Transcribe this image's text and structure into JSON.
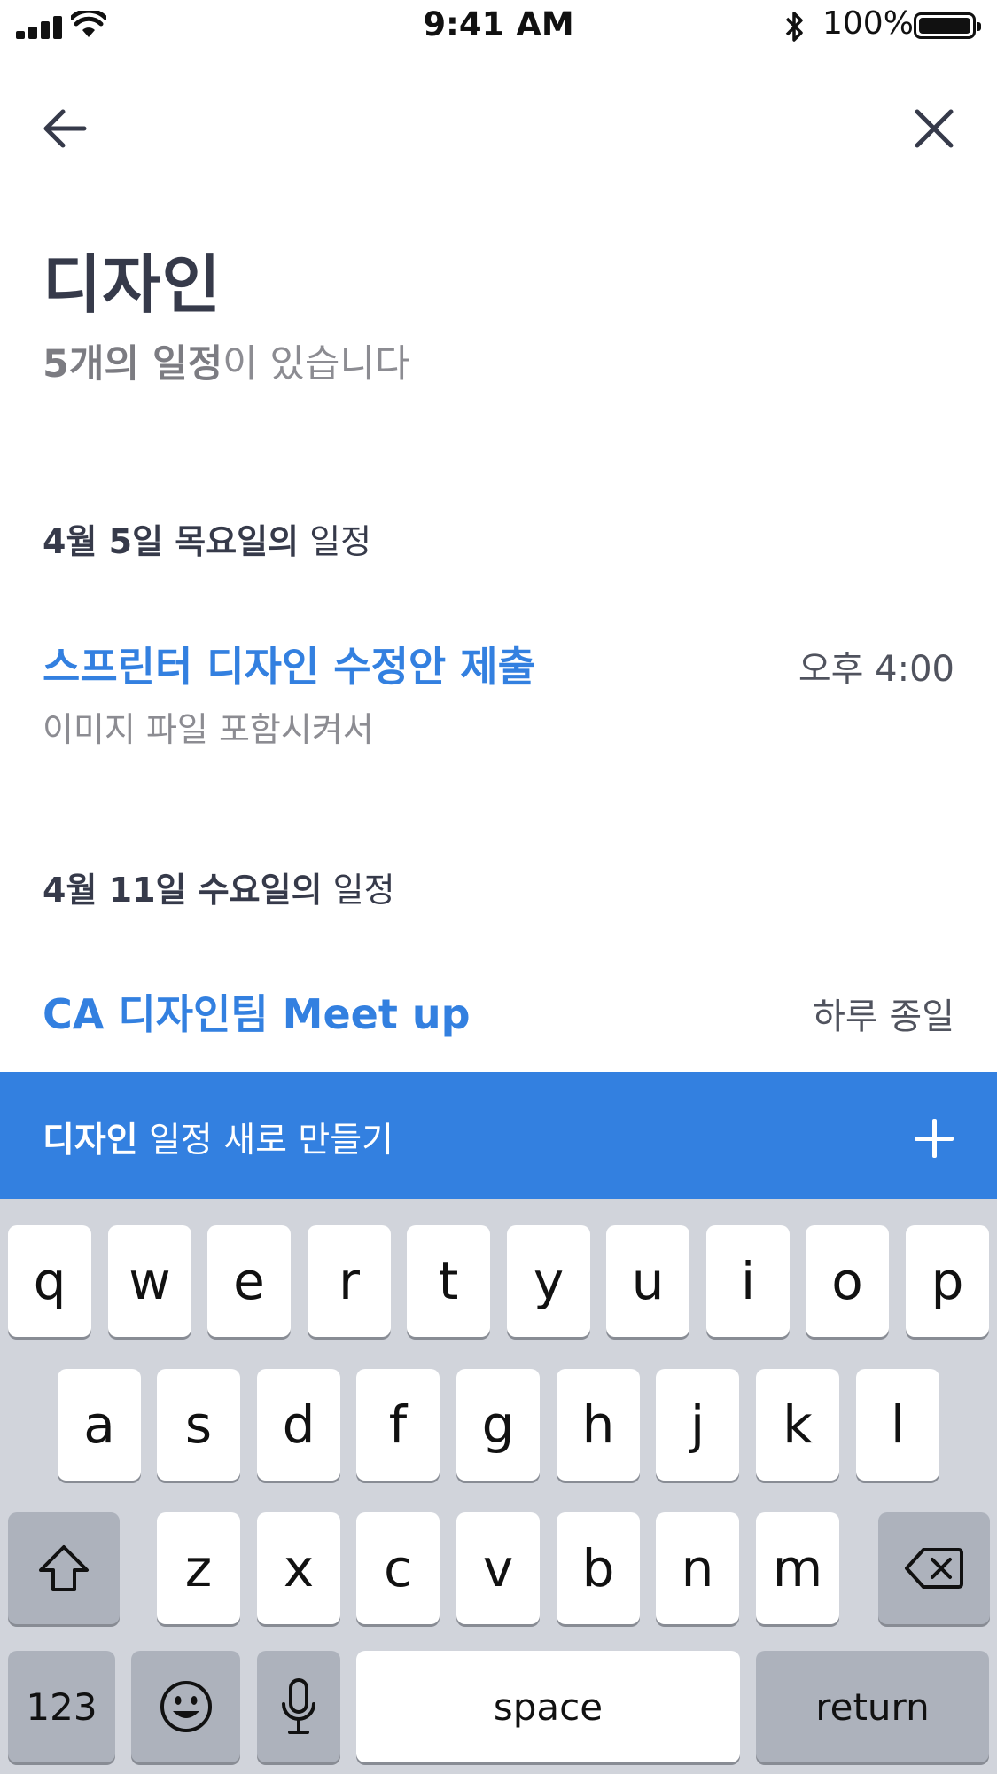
{
  "status_bar": {
    "time": "9:41 AM",
    "battery": "100%",
    "icons": [
      "signal-icon",
      "wifi-icon",
      "bluetooth-icon",
      "battery-icon"
    ]
  },
  "nav": {
    "back_icon": "arrow-left-icon",
    "close_icon": "close-icon"
  },
  "header": {
    "title": "디자인",
    "subtitle_bold": "5개의 일정",
    "subtitle_rest": "이 있습니다"
  },
  "sections": [
    {
      "date_bold": "4월 5일 목요일의",
      "date_rest": " 일정",
      "events": [
        {
          "title": "스프린터 디자인 수정안 제출",
          "note": "이미지 파일 포함시켜서",
          "time": "오후 4:00"
        }
      ]
    },
    {
      "date_bold": "4월 11일 수요일의",
      "date_rest": " 일정",
      "events": [
        {
          "title": "CA 디자인팀 Meet up",
          "time": "하루 종일"
        }
      ]
    }
  ],
  "create_bar": {
    "label_bold": "디자인",
    "label_rest": " 일정 새로 만들기",
    "icon": "plus-icon"
  },
  "keyboard": {
    "row1": [
      "q",
      "w",
      "e",
      "r",
      "t",
      "y",
      "u",
      "i",
      "o",
      "p"
    ],
    "row2": [
      "a",
      "s",
      "d",
      "f",
      "g",
      "h",
      "j",
      "k",
      "l"
    ],
    "row3": [
      "z",
      "x",
      "c",
      "v",
      "b",
      "n",
      "m"
    ],
    "numbers_label": "123",
    "space_label": "space",
    "return_label": "return",
    "icons": [
      "shift-icon",
      "backspace-icon",
      "emoji-icon",
      "microphone-icon"
    ]
  },
  "colors": {
    "accent": "#3380e0",
    "title_text": "#363a4a",
    "muted_text": "#8c8c92",
    "keyboard_bg": "#d1d4db",
    "dark_key": "#adb2bc"
  }
}
